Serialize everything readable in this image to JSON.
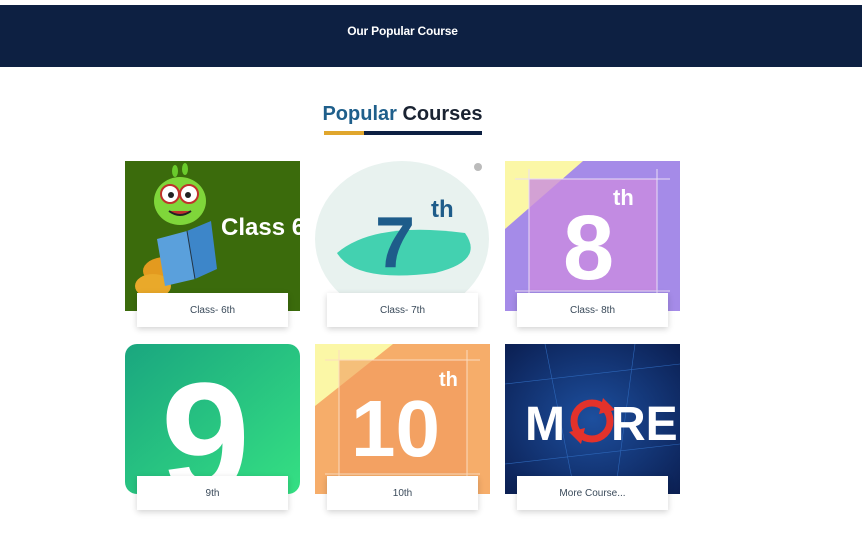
{
  "header": {
    "title": "Our Popular Course"
  },
  "section": {
    "title_accent": "Popular",
    "title_rest": "Courses"
  },
  "courses": [
    {
      "label": "Class- 6th",
      "thumb_text": "Class 6"
    },
    {
      "label": "Class- 7th",
      "thumb_number": "7",
      "thumb_suffix": "th"
    },
    {
      "label": "Class- 8th",
      "thumb_number": "8",
      "thumb_suffix": "th"
    },
    {
      "label": "9th",
      "thumb_number": "9"
    },
    {
      "label": "10th",
      "thumb_number": "10",
      "thumb_suffix": "th"
    },
    {
      "label": "More Course...",
      "thumb_text_a": "M",
      "thumb_text_b": "RE"
    }
  ],
  "colors": {
    "header_bg": "#0d2042",
    "title_accent": "#1f5f8b",
    "underline_gold": "#e0a62d"
  }
}
